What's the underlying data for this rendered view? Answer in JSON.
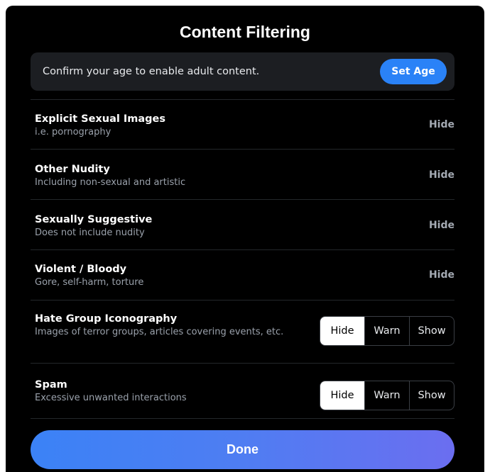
{
  "title": "Content Filtering",
  "age_banner": {
    "text": "Confirm your age to enable adult content.",
    "button_label": "Set Age"
  },
  "filters": [
    {
      "label": "Explicit Sexual Images",
      "description": "i.e. pornography",
      "value": "Hide"
    },
    {
      "label": "Other Nudity",
      "description": "Including non-sexual and artistic",
      "value": "Hide"
    },
    {
      "label": "Sexually Suggestive",
      "description": "Does not include nudity",
      "value": "Hide"
    },
    {
      "label": "Violent / Bloody",
      "description": "Gore, self-harm, torture",
      "value": "Hide"
    },
    {
      "label": "Hate Group Iconography",
      "description": "Images of terror groups, articles covering events, etc.",
      "options": [
        "Hide",
        "Warn",
        "Show"
      ],
      "selected": "Hide"
    },
    {
      "label": "Spam",
      "description": "Excessive unwanted interactions",
      "options": [
        "Hide",
        "Warn",
        "Show"
      ],
      "selected": "Hide"
    }
  ],
  "done_label": "Done",
  "colors": {
    "background": "#000000",
    "banner": "#1c1e22",
    "accent": "#2a82f7",
    "done_gradient_start": "#3b82f6",
    "done_gradient_end": "#6b6ef0"
  }
}
